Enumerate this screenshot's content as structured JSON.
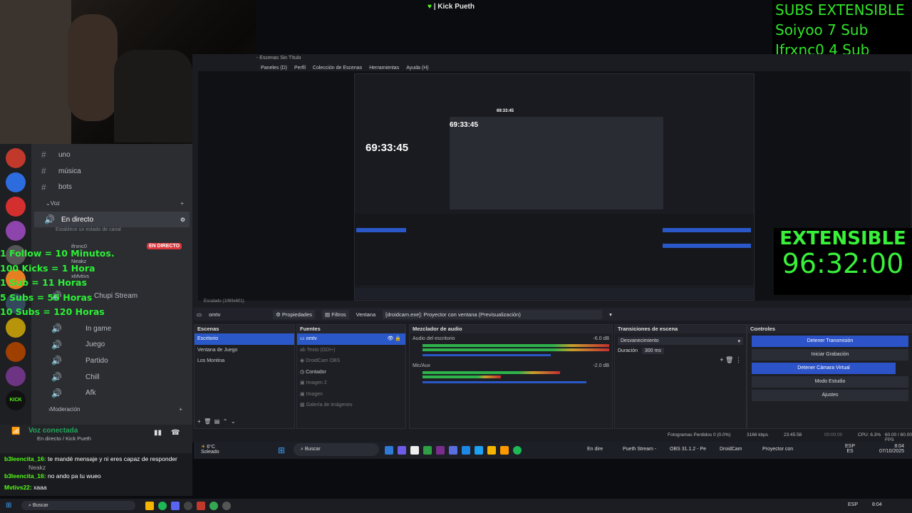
{
  "stream": {
    "title": "| Kick Pueth"
  },
  "subs": {
    "header": "SUBS EXTENSIBLE",
    "entries": [
      "Soiyoo 7 Sub",
      "Ifrxnc0 4 Sub"
    ]
  },
  "extensible": {
    "label": "EXTENSIBLE",
    "timer": "96:32:00"
  },
  "rules": [
    "1 Follow = 10 Minutos.",
    "100 Kicks = 1 Hora",
    "1 Sub = 11 Horas",
    "5 Subs = 55 Horas",
    "10 Subs = 120 Horas"
  ],
  "discord": {
    "channels": [
      {
        "label": "uno",
        "icon": "hash"
      },
      {
        "label": "música",
        "icon": "hash"
      },
      {
        "label": "bots",
        "icon": "hash"
      }
    ],
    "voice_category": "Voz",
    "live_channel": "En directo",
    "status_placeholder": "Establece un estado de canal",
    "live_badge": "EN DIRECTO",
    "members": [
      "ifrxnc0",
      "Neakz",
      "xMvtivs"
    ],
    "voice_channels": [
      {
        "label": "Chupi Stream"
      },
      {
        "label": "In game"
      },
      {
        "label": "Juego"
      },
      {
        "label": "Partido"
      },
      {
        "label": "Chill"
      },
      {
        "label": "Afk"
      }
    ],
    "moderation": "Moderación",
    "voice_connected": "Voz conectada",
    "voice_sub": "En directo / Kick Pueth"
  },
  "chat": [
    {
      "user": "b3leencita_16:",
      "text": "te mandé mensaje y ni eres capaz de responder"
    },
    {
      "user": "Neakz",
      "text": ""
    },
    {
      "user": "b3leencita_16:",
      "text": "no ando pa tu wueo"
    },
    {
      "user": "Mvtivs22:",
      "text": "xaaa"
    }
  ],
  "obs": {
    "window_title": "- Escenas Sin Título",
    "menu": [
      "Paneles (D)",
      "Perfil",
      "Colección de Escenas",
      "Herramientas",
      "Ayuda (H)"
    ],
    "clock_main": "69:33:45",
    "clock_nested": "69:33:45",
    "clock_nested2": "69:33:45",
    "zoom": "Escalado (1069x601)",
    "source_name": "omtv",
    "properties_label": "Propiedades",
    "filters_label": "Filtros",
    "window_label": "Ventana",
    "window_value": "[droidcam.exe]: Proyector con ventana (Previsualización)",
    "docks": {
      "scenes": {
        "title": "Escenas",
        "items": [
          "Escritorio",
          "Ventana de Juego",
          "Los Montina"
        ]
      },
      "sources": {
        "title": "Fuentes",
        "items": [
          "omtv",
          "Texto (GDI+)",
          "DroidCam OBS",
          "Contador",
          "Imagen 2",
          "Imagen",
          "Galería de imágenes"
        ]
      },
      "mixer": {
        "title": "Mezclador de audio",
        "channels": [
          {
            "name": "Audio del escritorio",
            "db": "-6.0 dB"
          },
          {
            "name": "Mic/Aux",
            "db": "-2.0 dB"
          }
        ]
      },
      "transitions": {
        "title": "Transiciones de escena",
        "type": "Desvanecimiento",
        "duration_label": "Duración",
        "duration": "300 ms"
      },
      "controls": {
        "title": "Controles",
        "buttons": [
          "Detener Transmisión",
          "Iniciar Grabación",
          "Detener Cámara Virtual",
          "Modo Estudio",
          "Ajustes"
        ]
      }
    },
    "status": {
      "dropped": "Fotogramas Perdidos 0 (0.0%)",
      "bitrate": "3166 kbps",
      "live_time": "23:45:58",
      "rec_time": "00:00:00",
      "cpu": "CPU: 6.3%",
      "fps": "60.00 / 60.00 FPS"
    }
  },
  "taskbar_obs": {
    "weather_temp": "6°C",
    "weather_desc": "Soleado",
    "search": "Buscar",
    "apps": [
      "En dire",
      "Pueth Stream -",
      "OBS 31.1.2 - Pe",
      "DroidCam",
      "Proyector con"
    ],
    "lang": "ESP",
    "lang_sub": "ES",
    "time": "8:04",
    "date": "07/10/2025"
  },
  "taskbar_main": {
    "search": "Buscar",
    "lang": "ESP",
    "time": "8:04"
  }
}
